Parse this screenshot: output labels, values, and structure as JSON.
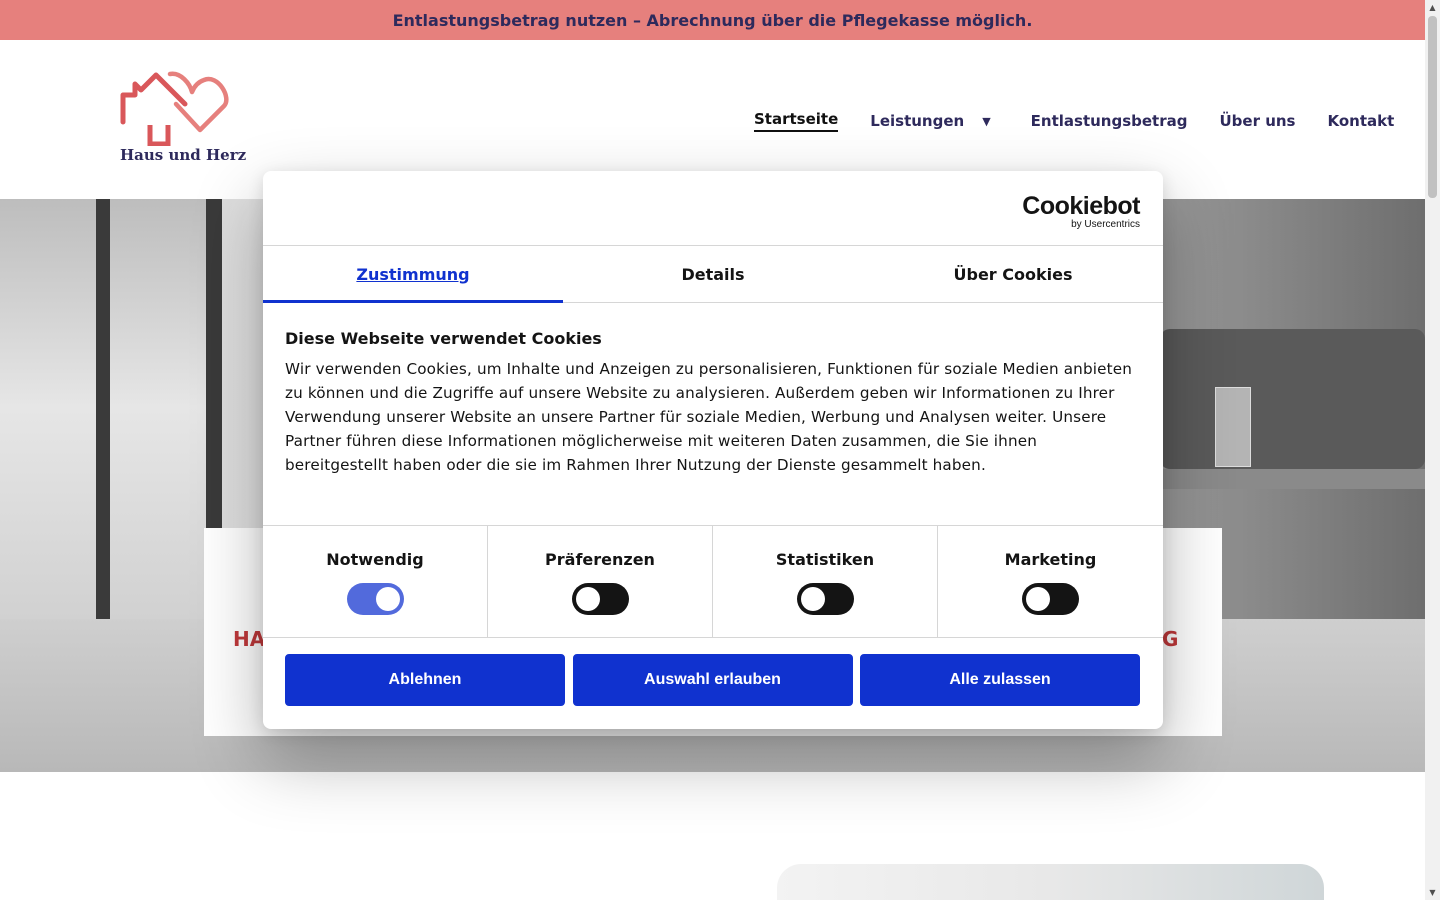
{
  "announcement": "Entlastungsbetrag nutzen – Abrechnung über die Pflegekasse möglich.",
  "brand": {
    "logo_text": "Haus und Herz",
    "primary_color": "#2e2a5c",
    "accent_color": "#d9575a"
  },
  "nav": {
    "items": [
      {
        "label": "Startseite",
        "active": true
      },
      {
        "label": "Leistungen",
        "has_dropdown": true
      },
      {
        "label": "Entlastungsbetrag"
      },
      {
        "label": "Über uns"
      },
      {
        "label": "Kontakt"
      }
    ]
  },
  "hero_cards": {
    "left_title_fragment": "HA",
    "right_title_fragment": "G"
  },
  "cookie_dialog": {
    "provider_logo": "Cookiebot",
    "provider_sub": "by Usercentrics",
    "tabs": [
      {
        "label": "Zustimmung",
        "active": true
      },
      {
        "label": "Details",
        "active": false
      },
      {
        "label": "Über Cookies",
        "active": false
      }
    ],
    "heading": "Diese Webseite verwendet Cookies",
    "body": "Wir verwenden Cookies, um Inhalte und Anzeigen zu personalisieren, Funktionen für soziale Medien anbieten zu können und die Zugriffe auf unsere Website zu analysieren. Außerdem geben wir Informationen zu Ihrer Verwendung unserer Website an unsere Partner für soziale Medien, Werbung und Analysen weiter. Unsere Partner führen diese Informationen möglicherweise mit weiteren Daten zusammen, die Sie ihnen bereitgestellt haben oder die sie im Rahmen Ihrer Nutzung der Dienste gesammelt haben.",
    "categories": [
      {
        "label": "Notwendig",
        "enabled": true
      },
      {
        "label": "Präferenzen",
        "enabled": false
      },
      {
        "label": "Statistiken",
        "enabled": false
      },
      {
        "label": "Marketing",
        "enabled": false
      }
    ],
    "buttons": {
      "decline": "Ablehnen",
      "allow_selection": "Auswahl erlauben",
      "allow_all": "Alle zulassen"
    },
    "accent_color": "#1032cf"
  },
  "icons": {
    "nav_dropdown": "caret-down-icon",
    "scroll_up": "arrow-up-icon",
    "scroll_down": "arrow-down-icon"
  }
}
